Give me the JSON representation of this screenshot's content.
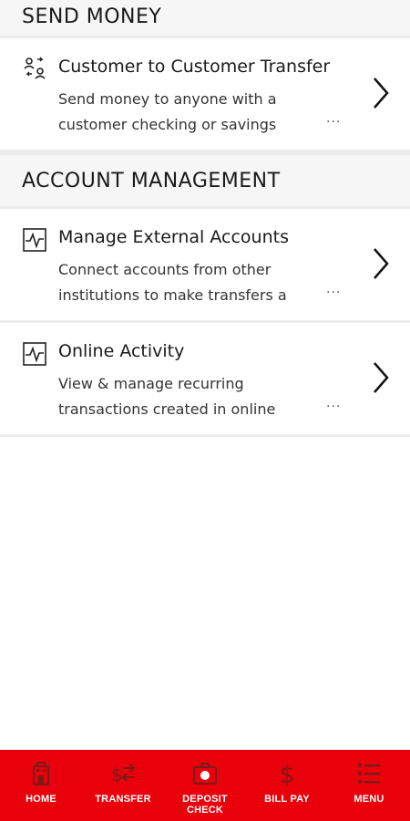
{
  "sections": {
    "send_money": {
      "title": "SEND MONEY",
      "items": [
        {
          "icon": "people-transfer-icon",
          "title": "Customer to Customer Transfer",
          "desc_line1": "Send money to anyone with a",
          "desc_line2": "customer checking or savings",
          "more": "..."
        }
      ]
    },
    "account_management": {
      "title": "ACCOUNT MANAGEMENT",
      "items": [
        {
          "icon": "activity-chart-icon",
          "title": "Manage External Accounts",
          "desc_line1": "Connect accounts from other",
          "desc_line2": "institutions to make transfers a",
          "more": "..."
        },
        {
          "icon": "activity-chart-icon",
          "title": "Online Activity",
          "desc_line1": "View & manage recurring",
          "desc_line2": "transactions created in online",
          "more": "..."
        }
      ]
    }
  },
  "tabbar": {
    "background": "#e8000b",
    "tabs": [
      {
        "label": "HOME",
        "icon": "home-icon"
      },
      {
        "label": "TRANSFER",
        "icon": "transfer-icon"
      },
      {
        "label_line1": "DEPOSIT",
        "label_line2": "CHECK",
        "icon": "camera-icon"
      },
      {
        "label": "BILL PAY",
        "icon": "dollar-icon"
      },
      {
        "label": "MENU",
        "icon": "menu-icon"
      }
    ]
  }
}
